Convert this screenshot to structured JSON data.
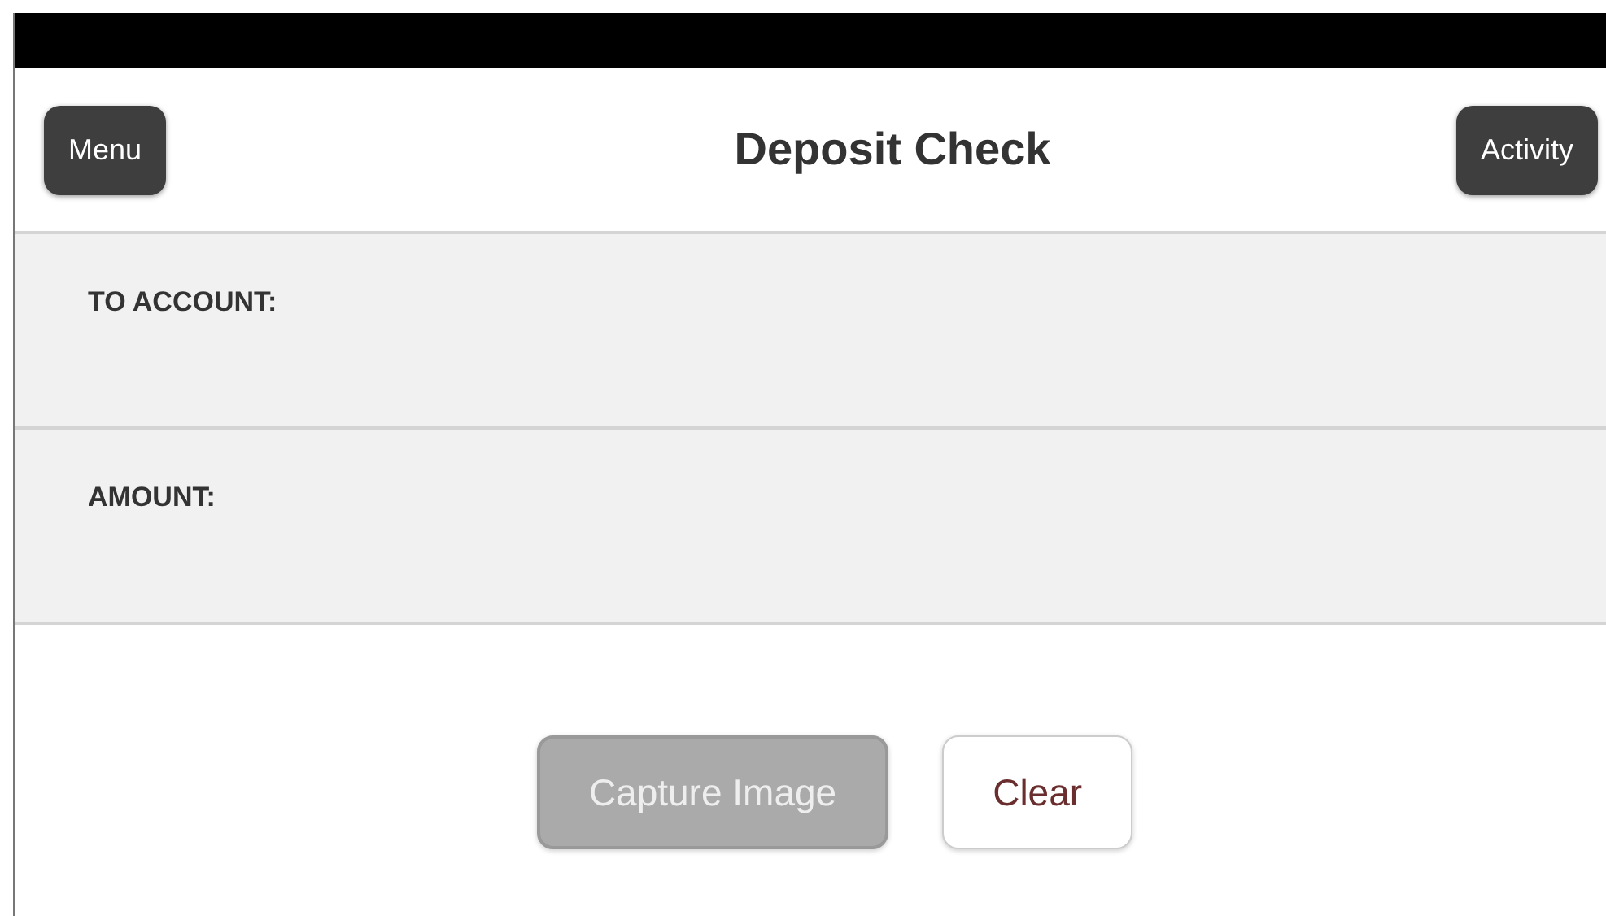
{
  "header": {
    "title": "Deposit Check",
    "left_button": "Menu",
    "right_button": "Activity"
  },
  "fields": [
    {
      "label": "TO ACCOUNT:"
    },
    {
      "label": "AMOUNT:"
    }
  ],
  "buttons": [
    {
      "label": "Capture Image",
      "disabled": true
    },
    {
      "label": "Clear",
      "disabled": false
    }
  ]
}
